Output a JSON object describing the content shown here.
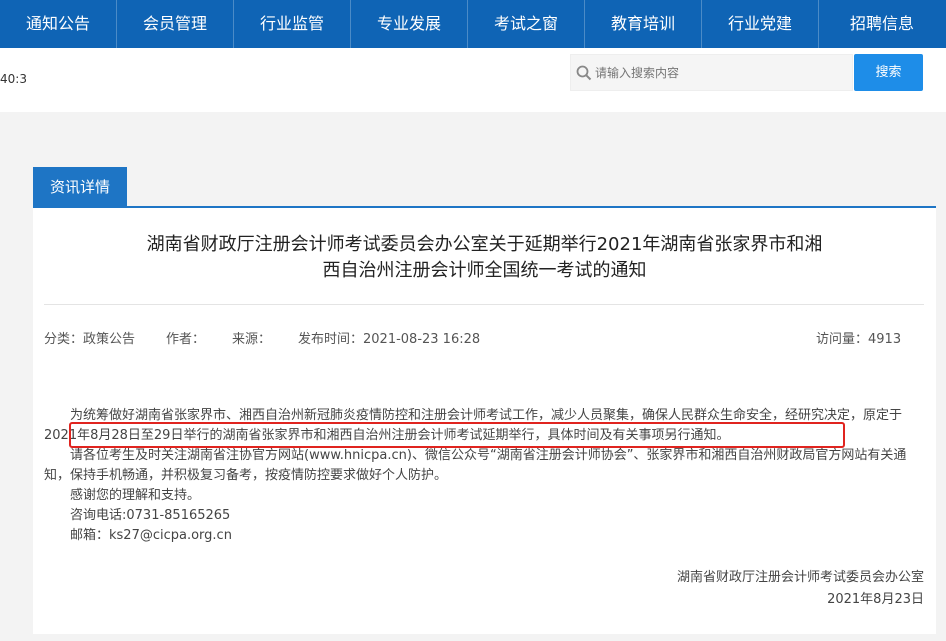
{
  "nav": [
    "通知公告",
    "会员管理",
    "行业监管",
    "专业发展",
    "考试之窗",
    "教育培训",
    "行业党建",
    "招聘信息"
  ],
  "topbar": {
    "time": "40:3",
    "search_placeholder": "请输入搜索内容",
    "search_button": "搜索"
  },
  "tab": "资讯详情",
  "article": {
    "title_line1": "湖南省财政厅注册会计师考试委员会办公室关于延期举行2021年湖南省张家界市和湘",
    "title_line2": "西自治州注册会计师全国统一考试的通知",
    "meta": {
      "category": "分类：政策公告",
      "author": "作者：",
      "source": "来源：",
      "published": "发布时间：2021-08-23 16:28",
      "views": "访问量：4913"
    },
    "p1_a": "为统筹做好湖南省张家界市、湘西自治州新冠肺炎疫情防控和注册会计师考试工作，减少人员聚集，确保人民群众生命安全，经研究决",
    "p1_b_prefix": "定，",
    "p1_b_highlight": "原定于2021年8月28日至29日举行的湖南省张家界市和湘西自治州注册会计师考试延期举行，具体时间及有关事项另行通知。",
    "p2": "请各位考生及时关注湖南省注协官方网站(www.hnicpa.cn)、微信公众号“湖南省注册会计师协会”、张家界市和湘西自治州财政局官方网站有关通知，保持手机畅通，并积极复习备考，按疫情防控要求做好个人防护。",
    "p3": "感谢您的理解和支持。",
    "p4": "咨询电话:0731-85165265",
    "p5": "邮箱：ks27@cicpa.org.cn",
    "sign_org": "湖南省财政厅注册会计师考试委员会办公室",
    "sign_date": "2021年8月23日"
  },
  "colors": {
    "nav_bg": "#0f64b5",
    "accent": "#1e75c5",
    "button": "#1e8de8",
    "highlight_border": "#e0241f"
  }
}
